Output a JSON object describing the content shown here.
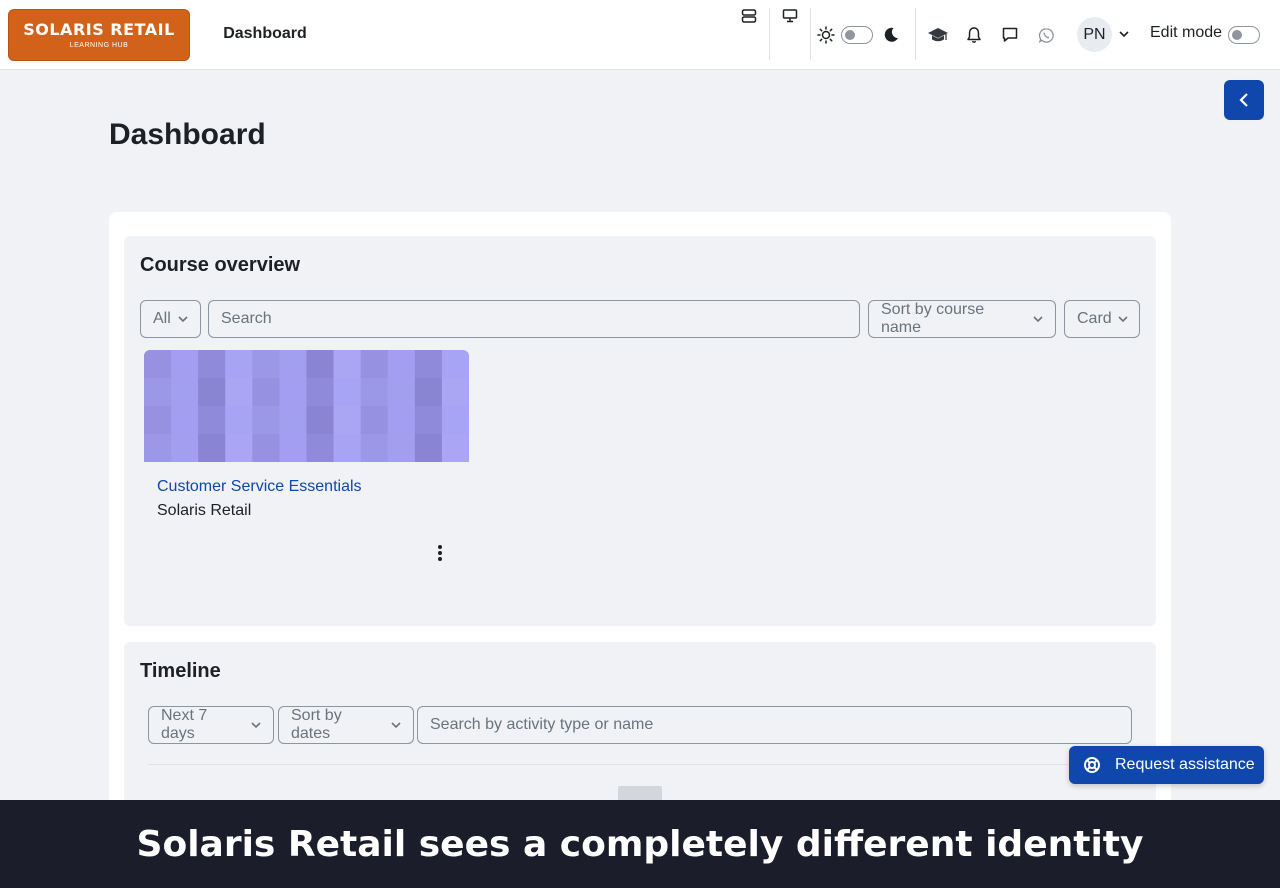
{
  "brand": {
    "title": "SOLARIS RETAIL",
    "subtitle": "LEARNING HUB",
    "color": "#d2621a"
  },
  "nav": {
    "primary_link": "Dashboard"
  },
  "header_icons": [
    "layout-rows-icon",
    "monitor-icon",
    "sun-icon",
    "moon-icon",
    "graduation-cap-icon",
    "bell-icon",
    "chat-icon",
    "whatsapp-icon"
  ],
  "user": {
    "initials": "PN"
  },
  "edit_mode": {
    "label": "Edit mode",
    "enabled": false
  },
  "theme_toggle": {
    "dark": false
  },
  "page": {
    "title": "Dashboard"
  },
  "course_overview": {
    "title": "Course overview",
    "filter": "All",
    "search_placeholder": "Search",
    "sort": "Sort by course name",
    "view": "Card",
    "courses": [
      {
        "name": "Customer Service Essentials",
        "category": "Solaris Retail"
      }
    ]
  },
  "timeline": {
    "title": "Timeline",
    "range": "Next 7 days",
    "sort": "Sort by dates",
    "search_placeholder": "Search by activity type or name"
  },
  "assistance": {
    "label": "Request assistance"
  },
  "caption": "Solaris Retail sees a completely different identity",
  "colors": {
    "primary": "#0f47ad",
    "brand": "#d2621a",
    "background": "#f0f2f5"
  }
}
